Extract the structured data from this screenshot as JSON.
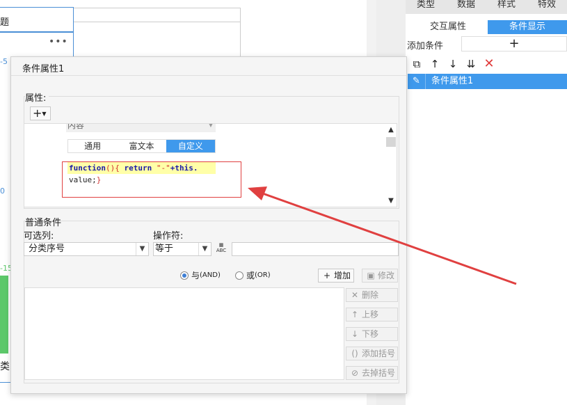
{
  "background": {
    "card_header": "题",
    "numbers": [
      "-5",
      "0",
      "-15"
    ],
    "bottom_text": "类"
  },
  "right_panel": {
    "tabs": [
      "类型",
      "数据",
      "样式",
      "特效"
    ],
    "sub_tabs": [
      "交互属性",
      "条件显示"
    ],
    "add_condition_label": "添加条件",
    "add_condition_button": "+",
    "condition_item": "条件属性1"
  },
  "dialog": {
    "title": "条件属性1",
    "attributes_group": "属性:",
    "add_dropdown": "+",
    "content_field": "内容",
    "editor_tabs": [
      "通用",
      "富文本",
      "自定义"
    ],
    "code_line1_kw": "function",
    "code_line1_br1": "(){",
    "code_line1_kw2": " return ",
    "code_line1_str": "\"-\"",
    "code_line1_rest": "+this.",
    "code_line2_text": "value;",
    "code_line2_br": "}",
    "general_group": "普通条件",
    "optional_label": "可选列:",
    "operator_label": "操作符:",
    "optional_value": "分类序号",
    "operator_value": "等于",
    "value_input": "",
    "and_label": "与",
    "and_sub": "(AND)",
    "or_label": "或",
    "or_sub": "(OR)",
    "buttons": {
      "add": "增加",
      "modify": "修改",
      "delete": "删除",
      "move_up": "上移",
      "move_down": "下移",
      "add_bracket": "添加括号",
      "remove_bracket": "去掉括号"
    }
  },
  "colors": {
    "accent": "#3f99ec",
    "annotation": "#e04040"
  }
}
